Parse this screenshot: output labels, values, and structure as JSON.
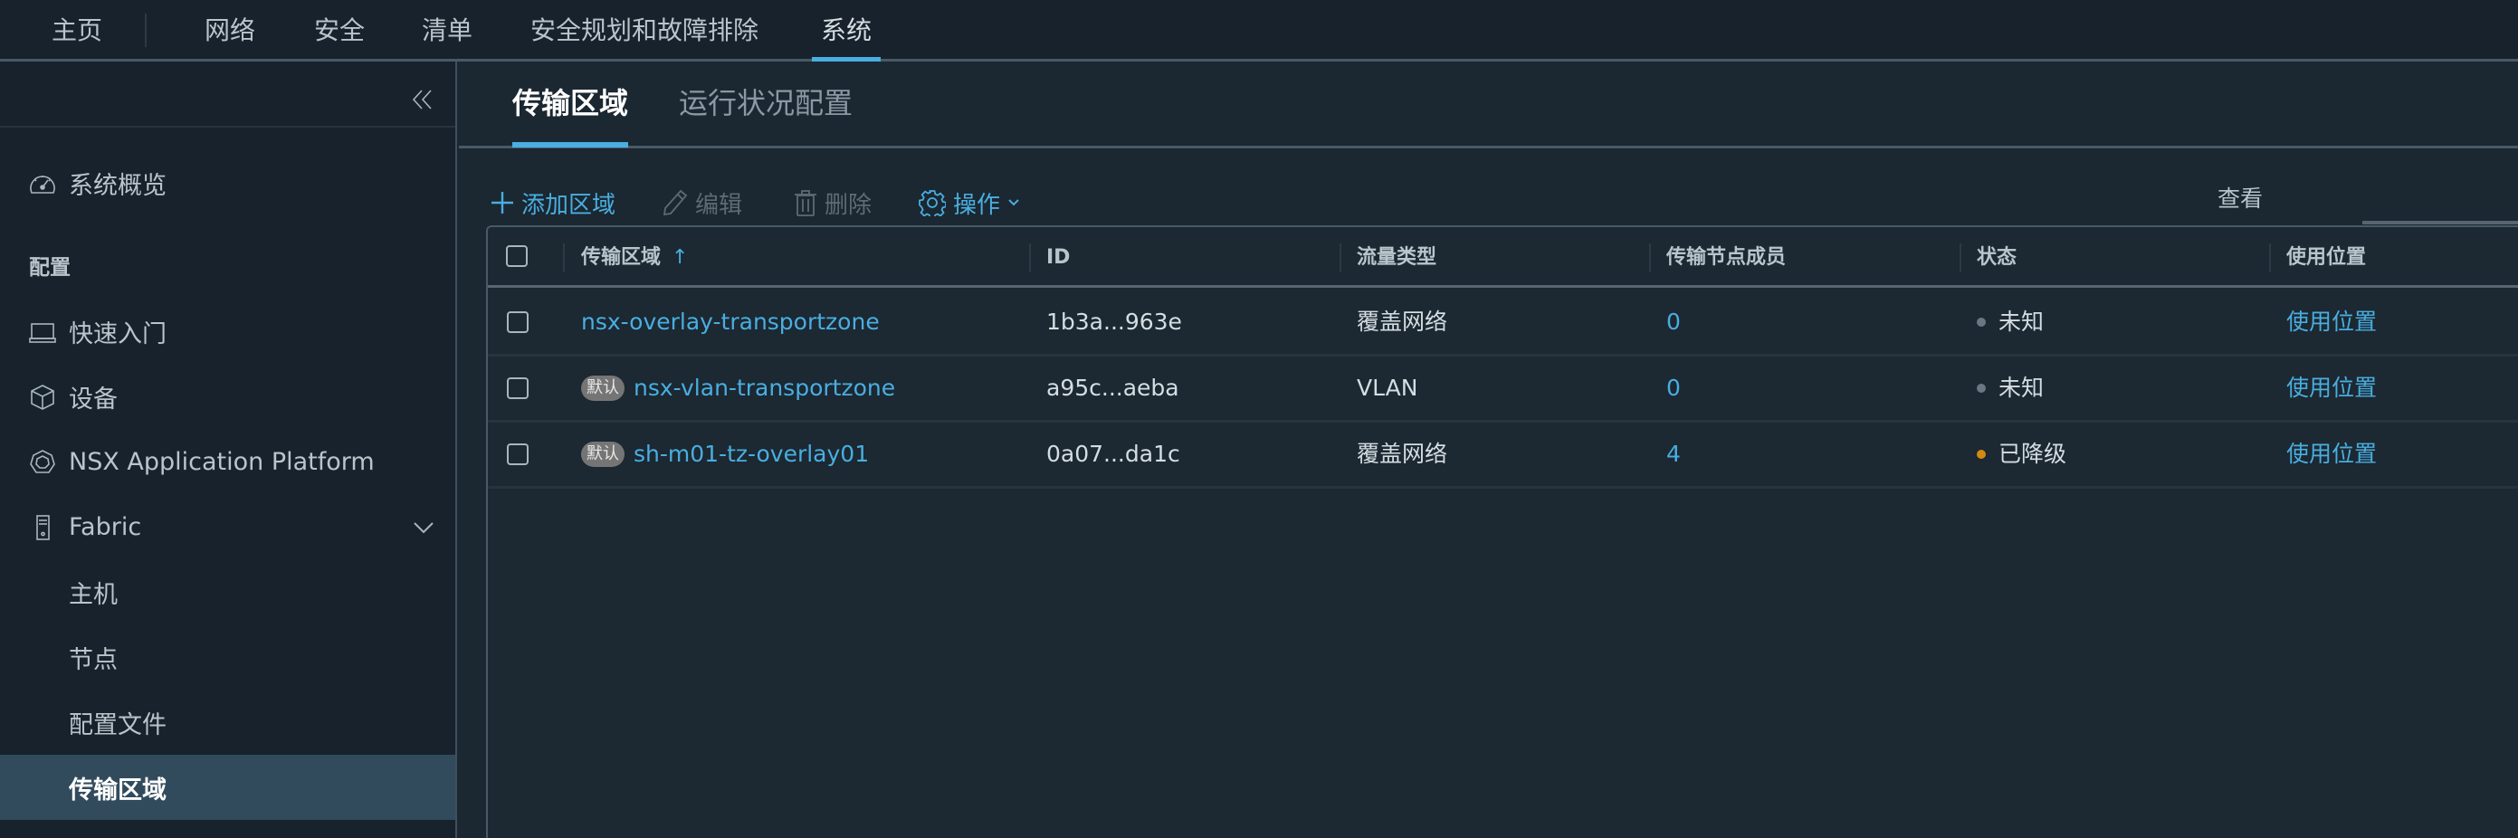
{
  "topnav": {
    "items": [
      {
        "label": "主页",
        "active": false
      },
      {
        "label": "网络",
        "active": false
      },
      {
        "label": "安全",
        "active": false
      },
      {
        "label": "清单",
        "active": false
      },
      {
        "label": "安全规划和故障排除",
        "active": false
      },
      {
        "label": "系统",
        "active": true
      }
    ]
  },
  "sidebar": {
    "collapse_icon": "double-chevron-left-icon",
    "overview": {
      "label": "系统概览",
      "icon": "dashboard-gauge-icon"
    },
    "section_label": "配置",
    "items": [
      {
        "label": "快速入门",
        "icon": "laptop-icon"
      },
      {
        "label": "设备",
        "icon": "cube-icon"
      },
      {
        "label": "NSX Application Platform",
        "icon": "heptagon-platform-icon"
      },
      {
        "label": "Fabric",
        "icon": "server-tower-icon",
        "expanded": true
      }
    ],
    "fabric_children": [
      {
        "label": "主机",
        "selected": false
      },
      {
        "label": "节点",
        "selected": false
      },
      {
        "label": "配置文件",
        "selected": false
      },
      {
        "label": "传输区域",
        "selected": true
      }
    ]
  },
  "main": {
    "tabs": [
      {
        "label": "传输区域",
        "active": true
      },
      {
        "label": "运行状况配置",
        "active": false
      }
    ],
    "toolbar": {
      "add": {
        "label": "添加区域",
        "icon": "plus-icon",
        "enabled": true
      },
      "edit": {
        "label": "编辑",
        "icon": "pencil-icon",
        "enabled": false
      },
      "delete": {
        "label": "删除",
        "icon": "trash-icon",
        "enabled": false
      },
      "actions": {
        "label": "操作",
        "icon": "gear-icon",
        "enabled": true
      }
    },
    "view_label": "查看",
    "table": {
      "columns": [
        "传输区域",
        "ID",
        "流量类型",
        "传输节点成员",
        "状态",
        "使用位置"
      ],
      "sort": {
        "column": "传输区域",
        "direction": "ascending",
        "icon": "↑"
      },
      "rows": [
        {
          "name": "nsx-overlay-transportzone",
          "default_badge": null,
          "id": "1b3a...963e",
          "traffic_type": "覆盖网络",
          "members": "0",
          "status": "未知",
          "status_color": "#6b7884",
          "usage": "使用位置"
        },
        {
          "name": "nsx-vlan-transportzone",
          "default_badge": "默认",
          "id": "a95c...aeba",
          "traffic_type": "VLAN",
          "members": "0",
          "status": "未知",
          "status_color": "#6b7884",
          "usage": "使用位置"
        },
        {
          "name": "sh-m01-tz-overlay01",
          "default_badge": "默认",
          "id": "0a07...da1c",
          "traffic_type": "覆盖网络",
          "members": "4",
          "status": "已降级",
          "status_color": "#d28b10",
          "usage": "使用位置"
        }
      ]
    }
  },
  "colors": {
    "accent": "#49aee0",
    "selected_bg": "#324b5c",
    "degraded": "#d28b10",
    "unknown": "#6b7884"
  }
}
